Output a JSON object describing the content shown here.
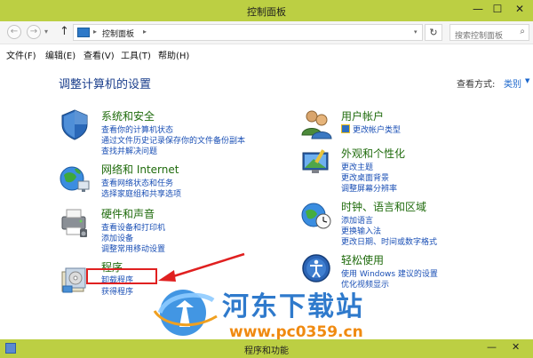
{
  "window": {
    "title": "控制面板",
    "minimize": "—",
    "maximize": "☐",
    "close": "✕"
  },
  "addressbar": {
    "back": "←",
    "forward": "→",
    "dropdown": "▾",
    "up": "↑",
    "separator": "▸",
    "breadcrumb": "控制面板",
    "refresh": "↻",
    "search_placeholder": "搜索控制面板",
    "search_icon": "search-icon"
  },
  "menu": [
    "文件(F)",
    "编辑(E)",
    "查看(V)",
    "工具(T)",
    "帮助(H)"
  ],
  "content": {
    "heading": "调整计算机的设置",
    "view_by_label": "查看方式:",
    "view_by_value": "类别",
    "view_by_arrow": "▼"
  },
  "categories": [
    {
      "title": "系统和安全",
      "icon": "shield-icon",
      "links": [
        "查看你的计算机状态",
        "通过文件历史记录保存你的文件备份副本",
        "查找并解决问题"
      ]
    },
    {
      "title": "网络和 Internet",
      "icon": "network-icon",
      "links": [
        "查看网络状态和任务",
        "选择家庭组和共享选项"
      ]
    },
    {
      "title": "硬件和声音",
      "icon": "printer-icon",
      "links": [
        "查看设备和打印机",
        "添加设备",
        "调整常用移动设置"
      ]
    },
    {
      "title": "程序",
      "icon": "programs-icon",
      "links": [
        "卸载程序",
        "获得程序"
      ]
    },
    {
      "title": "用户帐户",
      "icon": "users-icon",
      "links": [
        "更改帐户类型"
      ]
    },
    {
      "title": "外观和个性化",
      "icon": "appearance-icon",
      "links": [
        "更改主题",
        "更改桌面背景",
        "调整屏幕分辨率"
      ]
    },
    {
      "title": "时钟、语言和区域",
      "icon": "clock-globe-icon",
      "links": [
        "添加语言",
        "更换输入法",
        "更改日期、时间或数字格式"
      ]
    },
    {
      "title": "轻松使用",
      "icon": "ease-of-access-icon",
      "links": [
        "使用 Windows 建议的设置",
        "优化视频显示"
      ]
    }
  ],
  "watermark": {
    "title": "河东下载站",
    "url": "www.pc0359.cn"
  },
  "statusbar": {
    "title": "程序和功能",
    "minimize": "—",
    "close": "✕"
  },
  "colors": {
    "accent": "#bccf43",
    "link": "#1a4fb5",
    "category_title": "#1f6b0c",
    "heading": "#1a3e8c",
    "annotation": "#e02020"
  }
}
